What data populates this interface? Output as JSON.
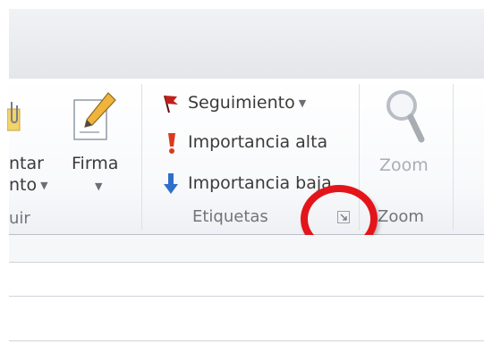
{
  "ribbon": {
    "include_group": {
      "attach_label_line1": "ntar",
      "attach_label_line2": "nto",
      "group_label": "uir"
    },
    "signature": {
      "label": "Firma"
    },
    "tags_group": {
      "followup_label": "Seguimiento",
      "high_importance_label": "Importancia alta",
      "low_importance_label": "Importancia baja",
      "group_label": "Etiquetas"
    },
    "zoom_group": {
      "button_label": "Zoom",
      "group_label": "Zoom"
    }
  },
  "colors": {
    "highlight_circle": "#e3151a",
    "flag": "#c0201b",
    "low_importance_arrow": "#2f6fc9"
  },
  "icons": {
    "attach": "paperclip-icon",
    "signature": "signature-pen-icon",
    "followup": "flag-icon",
    "high_importance": "exclamation-icon",
    "low_importance": "down-arrow-icon",
    "zoom": "magnifier-icon",
    "dialog_launcher": "dialog-launcher-icon"
  }
}
